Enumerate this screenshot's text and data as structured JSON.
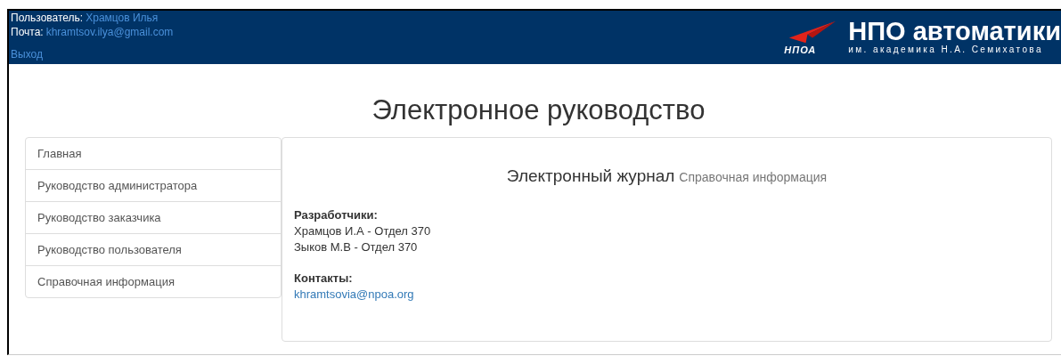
{
  "header": {
    "user_label": "Пользователь:",
    "user_name": "Храмцов Илья",
    "mail_label": "Почта:",
    "mail": "khramtsov.ilya@gmail.com",
    "logout": "Выход",
    "logo": {
      "mark": "НПОА",
      "title": "НПО автоматики",
      "subtitle": "им. академика Н.А. Семихатова"
    }
  },
  "page_title": "Электронное руководство",
  "sidebar": {
    "items": [
      {
        "label": "Главная"
      },
      {
        "label": "Руководство администратора"
      },
      {
        "label": "Руководство заказчика"
      },
      {
        "label": "Руководство пользователя"
      },
      {
        "label": "Справочная информация"
      }
    ]
  },
  "content": {
    "title": "Электронный журнал",
    "subtitle": "Справочная информация",
    "sections": [
      {
        "heading": "Разработчики:",
        "lines": [
          {
            "kind": "text",
            "text": "Храмцов И.А - Отдел 370"
          },
          {
            "kind": "text",
            "text": "Зыков М.В - Отдел 370"
          }
        ]
      },
      {
        "heading": "Контакты:",
        "lines": [
          {
            "kind": "link",
            "text": "khramtsovia@npoa.org"
          }
        ]
      }
    ]
  }
}
